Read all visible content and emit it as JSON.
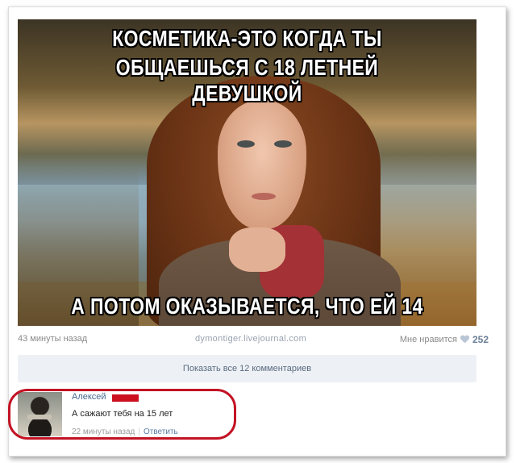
{
  "post": {
    "meme_top_line1": "КОСМЕТИКА-ЭТО КОГДА ТЫ",
    "meme_top_line2": "ОБЩАЕШЬСЯ С 18 ЛЕТНЕЙ ДЕВУШКОЙ",
    "meme_bottom_line": "А ПОТОМ ОКАЗЫВАЕТСЯ, ЧТО ЕЙ 14",
    "time": "43 минуты назад",
    "source": "dymontiger.livejournal.com",
    "likes_label": "Мне нравится",
    "likes_count": "252",
    "show_all_comments": "Показать все 12 комментариев"
  },
  "comment": {
    "author": "Алексей",
    "text": "А сажают тебя на 15 лет",
    "time": "22 минуты назад",
    "separator": "|",
    "reply_label": "Ответить"
  },
  "colors": {
    "highlight": "#c31224",
    "link": "#45688e",
    "show_all_bg": "#edf1f5"
  }
}
